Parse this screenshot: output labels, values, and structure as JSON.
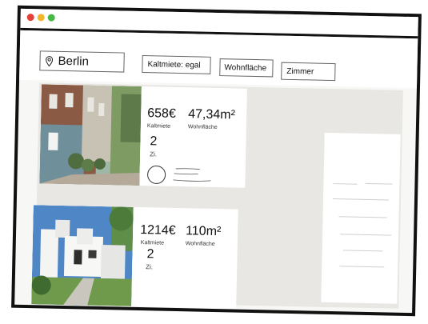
{
  "window": {
    "controls": [
      "close",
      "minimize",
      "maximize"
    ]
  },
  "search": {
    "value": "Berlin",
    "icon": "location-pin-icon"
  },
  "filters": {
    "rent": "Kaltmiete: egal",
    "area": "Wohnfläche",
    "rooms": "Zimmer"
  },
  "listings": [
    {
      "price": "658€",
      "price_label": "Kaltmiete",
      "area": "47,34m²",
      "area_label": "Wohnfläche",
      "rooms": "2",
      "rooms_label": "Zi."
    },
    {
      "price": "1214€",
      "price_label": "Kaltmiete",
      "area": "110m²",
      "area_label": "Wohnfläche",
      "rooms": "2",
      "rooms_label": "Zi."
    }
  ],
  "colors": {
    "frame": "#111111",
    "background": "#e8e7e3",
    "card": "#ffffff"
  }
}
